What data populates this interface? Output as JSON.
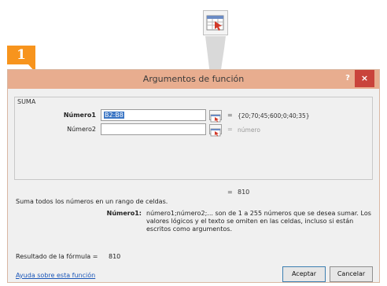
{
  "step_badge": {
    "number": "1"
  },
  "dialog": {
    "title": "Argumentos de función",
    "help_label": "?",
    "close_label": "×",
    "function_name": "SUMA",
    "args": [
      {
        "label": "Número1",
        "value": "B2:B8",
        "equals": "=",
        "result": "{20;70;45;600;0;40;35}"
      },
      {
        "label": "Número2",
        "value": "",
        "equals": "=",
        "result": "número"
      }
    ],
    "result_equals": "=",
    "result_value": "810",
    "description": "Suma todos los números en un rango de celdas.",
    "arg_help_label": "Número1:",
    "arg_help_text": "número1;número2;... son de 1 a 255 números que se desea sumar. Los valores lógicos y el texto se omiten en las celdas, incluso si están escritos como argumentos.",
    "formula_result_label": "Resultado de la fórmula =",
    "formula_result_value": "810",
    "help_link": "Ayuda sobre esta función",
    "ok_label": "Aceptar",
    "cancel_label": "Cancelar"
  }
}
